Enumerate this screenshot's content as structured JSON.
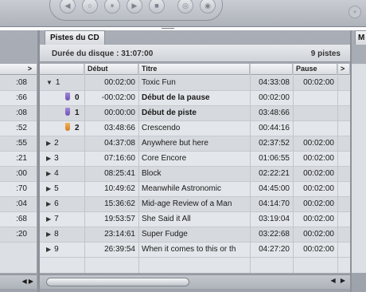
{
  "toolbar": {
    "buttons": [
      "play-icon",
      "pause-icon",
      "stop-icon",
      "record-icon",
      "skip-icon",
      "loop-icon",
      "reverse-icon"
    ],
    "corner_icon": "plus-icon"
  },
  "main_tab": {
    "label": "Pistes du CD"
  },
  "right_tab": {
    "label": "M"
  },
  "info": {
    "duration": "Durée du disque : 31:07:00",
    "track_count": "9 pistes"
  },
  "columns": {
    "col1": "",
    "col2": "Début",
    "col3": "Titre",
    "col4": "",
    "col5": "Pause",
    "col6": ">"
  },
  "rows": [
    {
      "num": "1",
      "disc": "▼",
      "marker": "",
      "start": "00:02:00",
      "title": "Toxic Fun",
      "dur": "04:33:08",
      "pause": "00:02:00",
      "bold": false
    },
    {
      "num": "0",
      "disc": "",
      "marker": "purple",
      "start": "-00:02:00",
      "title": "Début de la pause",
      "dur": "00:02:00",
      "pause": "",
      "bold": true
    },
    {
      "num": "1",
      "disc": "",
      "marker": "purple",
      "start": "00:00:00",
      "title": "Début de piste",
      "dur": "03:48:66",
      "pause": "",
      "bold": true
    },
    {
      "num": "2",
      "disc": "",
      "marker": "orange",
      "start": "03:48:66",
      "title": "Crescendo",
      "dur": "00:44:16",
      "pause": "",
      "bold": false
    },
    {
      "num": "2",
      "disc": "▶",
      "marker": "",
      "start": "04:37:08",
      "title": "Anywhere but here",
      "dur": "02:37:52",
      "pause": "00:02:00",
      "bold": false
    },
    {
      "num": "3",
      "disc": "▶",
      "marker": "",
      "start": "07:16:60",
      "title": "Core Encore",
      "dur": "01:06:55",
      "pause": "00:02:00",
      "bold": false
    },
    {
      "num": "4",
      "disc": "▶",
      "marker": "",
      "start": "08:25:41",
      "title": "Block",
      "dur": "02:22:21",
      "pause": "00:02:00",
      "bold": false
    },
    {
      "num": "5",
      "disc": "▶",
      "marker": "",
      "start": "10:49:62",
      "title": "Meanwhile Astronomic",
      "dur": "04:45:00",
      "pause": "00:02:00",
      "bold": false
    },
    {
      "num": "6",
      "disc": "▶",
      "marker": "",
      "start": "15:36:62",
      "title": "Mid-age Review of a Man",
      "dur": "04:14:70",
      "pause": "00:02:00",
      "bold": false
    },
    {
      "num": "7",
      "disc": "▶",
      "marker": "",
      "start": "19:53:57",
      "title": "She Said it All",
      "dur": "03:19:04",
      "pause": "00:02:00",
      "bold": false
    },
    {
      "num": "8",
      "disc": "▶",
      "marker": "",
      "start": "23:14:61",
      "title": "Super Fudge",
      "dur": "03:22:68",
      "pause": "00:02:00",
      "bold": false
    },
    {
      "num": "9",
      "disc": "▶",
      "marker": "",
      "start": "26:39:54",
      "title": "When it comes to this or th",
      "dur": "04:27:20",
      "pause": "00:02:00",
      "bold": false
    }
  ],
  "left_partial": {
    "header": ">",
    "values": [
      ":08",
      ":66",
      ":08",
      ":52",
      ":55",
      ":21",
      ":00",
      ":70",
      ":04",
      ":68",
      ":20"
    ]
  },
  "scroll_arrows": "◀ ▶"
}
